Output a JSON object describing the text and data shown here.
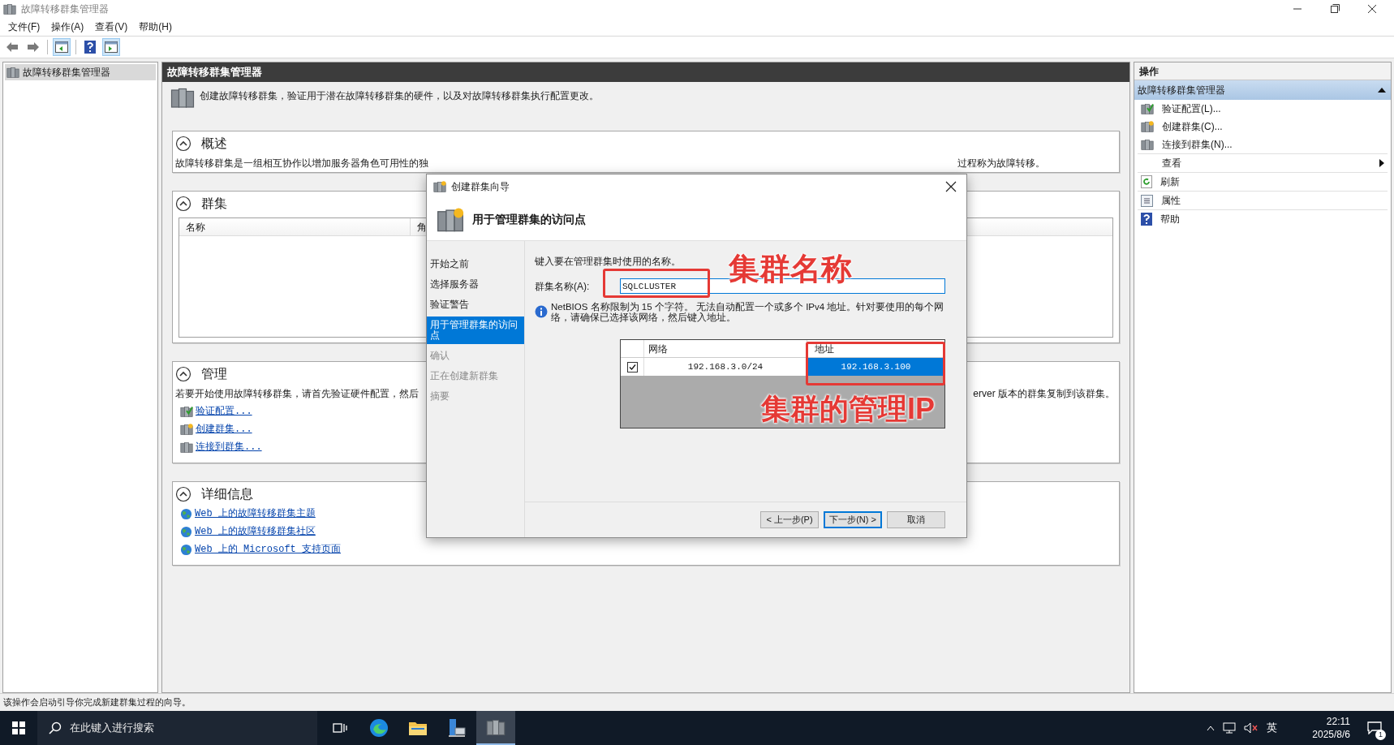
{
  "window": {
    "title": "故障转移群集管理器"
  },
  "menu": [
    {
      "label": "文件(F)"
    },
    {
      "label": "操作(A)"
    },
    {
      "label": "查看(V)"
    },
    {
      "label": "帮助(H)"
    }
  ],
  "toolbar": [
    {
      "kind": "back",
      "pressed": false
    },
    {
      "kind": "forward",
      "pressed": false
    },
    {
      "kind": "tree",
      "pressed": true
    },
    {
      "kind": "help",
      "pressed": false
    },
    {
      "kind": "pane",
      "pressed": true
    }
  ],
  "tree": [
    {
      "label": "故障转移群集管理器",
      "selected": true
    }
  ],
  "center": {
    "header": "故障转移群集管理器",
    "intro": "创建故障转移群集，验证用于潜在故障转移群集的硬件，以及对故障转移群集执行配置更改。",
    "sections": [
      {
        "kind": "text",
        "title": "概述",
        "expanded": true,
        "text_left": "故障转移群集是一组相互协作以增加服务器角色可用性的独",
        "text_right": "过程称为故障转移。"
      },
      {
        "kind": "table",
        "title": "群集",
        "expanded": true,
        "columns": [
          "名称",
          "角"
        ]
      },
      {
        "kind": "links",
        "title": "管理",
        "expanded": true,
        "text_left": "若要开始使用故障转移群集，请首先验证硬件配置，然后",
        "text_right": "erver 版本的群集复制到该群集。",
        "links": [
          {
            "label": "验证配置...",
            "kind": "validate"
          },
          {
            "label": "创建群集...",
            "kind": "create"
          },
          {
            "label": "连接到群集...",
            "kind": "connect"
          }
        ]
      },
      {
        "kind": "links",
        "title": "详细信息",
        "expanded": true,
        "links": [
          {
            "label": "Web 上的故障转移群集主题",
            "kind": "web"
          },
          {
            "label": "Web 上的故障转移群集社区",
            "kind": "web"
          },
          {
            "label": "Web 上的 Microsoft 支持页面",
            "kind": "web"
          }
        ]
      }
    ]
  },
  "actions": {
    "header": "操作",
    "group": {
      "label": "故障转移群集管理器",
      "expanded": true
    },
    "items": [
      {
        "label": "验证配置(L)...",
        "kind": "validate",
        "submenu": false
      },
      {
        "label": "创建群集(C)...",
        "kind": "create",
        "submenu": false
      },
      {
        "label": "连接到群集(N)...",
        "kind": "connect",
        "submenu": false
      },
      {
        "label": "查看",
        "kind": "view",
        "submenu": true
      },
      {
        "label": "刷新",
        "kind": "refresh",
        "submenu": false
      },
      {
        "label": "属性",
        "kind": "properties",
        "submenu": false
      },
      {
        "label": "帮助",
        "kind": "help",
        "submenu": false
      }
    ]
  },
  "status_bar": "该操作会启动引导你完成新建群集过程的向导。",
  "dialog": {
    "title": "创建群集向导",
    "heading": "用于管理群集的访问点",
    "steps": [
      {
        "label": "开始之前",
        "selected": false,
        "disabled": false
      },
      {
        "label": "选择服务器",
        "selected": false,
        "disabled": false
      },
      {
        "label": "验证警告",
        "selected": false,
        "disabled": false
      },
      {
        "label": "用于管理群集的访问点",
        "selected": true,
        "disabled": false
      },
      {
        "label": "确认",
        "selected": false,
        "disabled": true
      },
      {
        "label": "正在创建新群集",
        "selected": false,
        "disabled": true
      },
      {
        "label": "摘要",
        "selected": false,
        "disabled": true
      }
    ],
    "prompt": "键入要在管理群集时使用的名称。",
    "name_label": "群集名称(A):",
    "name_value": "SQLCLUSTER",
    "info": "NetBIOS 名称限制为 15 个字符。 无法自动配置一个或多个 IPv4 地址。针对要使用的每个网络，请确保已选择该网络，然后键入地址。",
    "columns": [
      "网络",
      "地址"
    ],
    "rows": [
      {
        "checked": true,
        "network": "192.168.3.0/24",
        "address": "192.168.3.100",
        "selected": true
      }
    ],
    "buttons": [
      {
        "label": "< 上一步(P)",
        "default": false
      },
      {
        "label": "下一步(N) >",
        "default": true
      },
      {
        "label": "取消",
        "default": false
      }
    ]
  },
  "annotations": [
    {
      "kind": "name",
      "label": "集群名称"
    },
    {
      "kind": "ip",
      "label": "集群的管理IP"
    }
  ],
  "taskbar": {
    "search_placeholder": "在此键入进行搜索",
    "apps": [
      {
        "kind": "taskview",
        "active": false
      },
      {
        "kind": "browser",
        "active": false
      },
      {
        "kind": "folder",
        "active": false
      },
      {
        "kind": "server",
        "active": false
      },
      {
        "kind": "cluster",
        "active": true
      }
    ],
    "ime": "英",
    "time": "22:11",
    "date": "2025/8/6",
    "notifications": "1"
  }
}
